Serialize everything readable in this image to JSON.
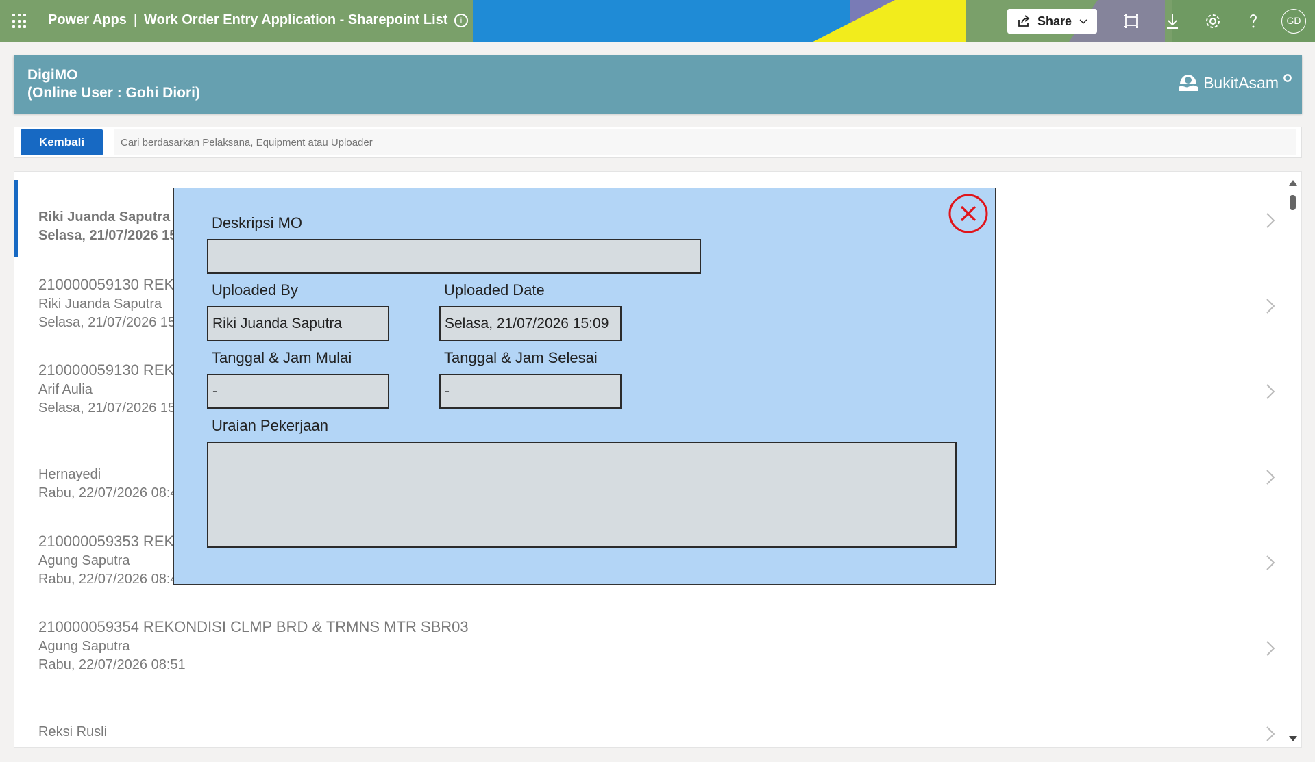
{
  "topbar": {
    "product": "Power Apps",
    "separator": "|",
    "app_name": "Work Order Entry Application - Sharepoint List",
    "info_glyph": "i",
    "share_label": "Share",
    "avatar_initials": "GD",
    "icons": [
      "waffle-icon",
      "info-icon",
      "share-icon",
      "chevron-down-icon",
      "fit-screen-icon",
      "download-icon",
      "settings-icon",
      "help-icon"
    ]
  },
  "header": {
    "title": "DigiMO",
    "subtitle": "(Online User : Gohi Diori)",
    "brand": "BukitAsam"
  },
  "search": {
    "back_label": "Kembali",
    "placeholder": "Cari berdasarkan Pelaksana, Equipment atau Uploader"
  },
  "list": {
    "items": [
      {
        "title": "",
        "person": "Riki Juanda Saputra",
        "date": "Selasa, 21/07/2026 15:",
        "selected": true
      },
      {
        "title": "210000059130 REK",
        "person": "Riki Juanda Saputra",
        "date": "Selasa, 21/07/2026 15:"
      },
      {
        "title": "210000059130 REK",
        "person": "Arif Aulia",
        "date": "Selasa, 21/07/2026 15:"
      },
      {
        "title": "",
        "person": "Hernayedi",
        "date": "Rabu, 22/07/2026 08:4"
      },
      {
        "title": "210000059353 REK",
        "person": "Agung Saputra",
        "date": "Rabu, 22/07/2026 08:4"
      },
      {
        "title": "210000059354 REKONDISI CLMP BRD & TRMNS MTR SBR03",
        "person": "Agung Saputra",
        "date": "Rabu, 22/07/2026 08:51"
      },
      {
        "title": "",
        "person": "Reksi Rusli",
        "date": ""
      }
    ]
  },
  "modal": {
    "deskripsi_label": "Deskripsi MO",
    "deskripsi_value": "",
    "uploaded_by_label": "Uploaded By",
    "uploaded_by_value": "Riki Juanda Saputra",
    "uploaded_date_label": "Uploaded Date",
    "uploaded_date_value": "Selasa, 21/07/2026 15:09",
    "mulai_label": "Tanggal & Jam Mulai",
    "mulai_value": "-",
    "selesai_label": "Tanggal & Jam Selesai",
    "selesai_value": "-",
    "uraian_label": "Uraian Pekerjaan",
    "uraian_value": ""
  },
  "colors": {
    "accent": "#1769c3",
    "header_panel": "#66a0b0",
    "modal_bg": "#b3d5f6",
    "field_bg": "#d6dce0",
    "close_red": "#e0151b"
  }
}
